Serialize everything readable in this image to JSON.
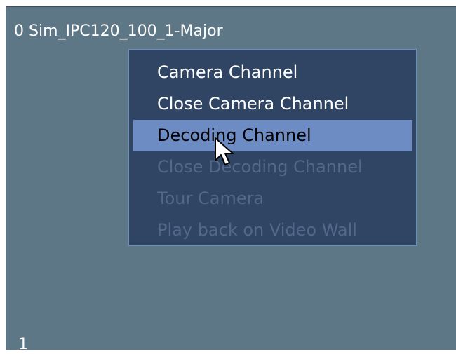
{
  "window": {
    "channel_title": "0  Sim_IPC120_100_1-Major",
    "channel_index": "1"
  },
  "context_menu": {
    "items": [
      {
        "label": "Camera Channel",
        "state": "enabled"
      },
      {
        "label": "Close Camera Channel",
        "state": "enabled"
      },
      {
        "label": "Decoding Channel",
        "state": "highlighted"
      },
      {
        "label": "Close Decoding Channel",
        "state": "disabled"
      },
      {
        "label": "Tour Camera",
        "state": "disabled"
      },
      {
        "label": "Play back on Video Wall",
        "state": "disabled"
      }
    ]
  },
  "colors": {
    "background": "#5e7787",
    "menu_background": "#2f4563",
    "menu_highlight": "#6d8cc4",
    "disabled_text": "#52688a"
  },
  "icons": {
    "cursor": "mouse-pointer-icon"
  }
}
